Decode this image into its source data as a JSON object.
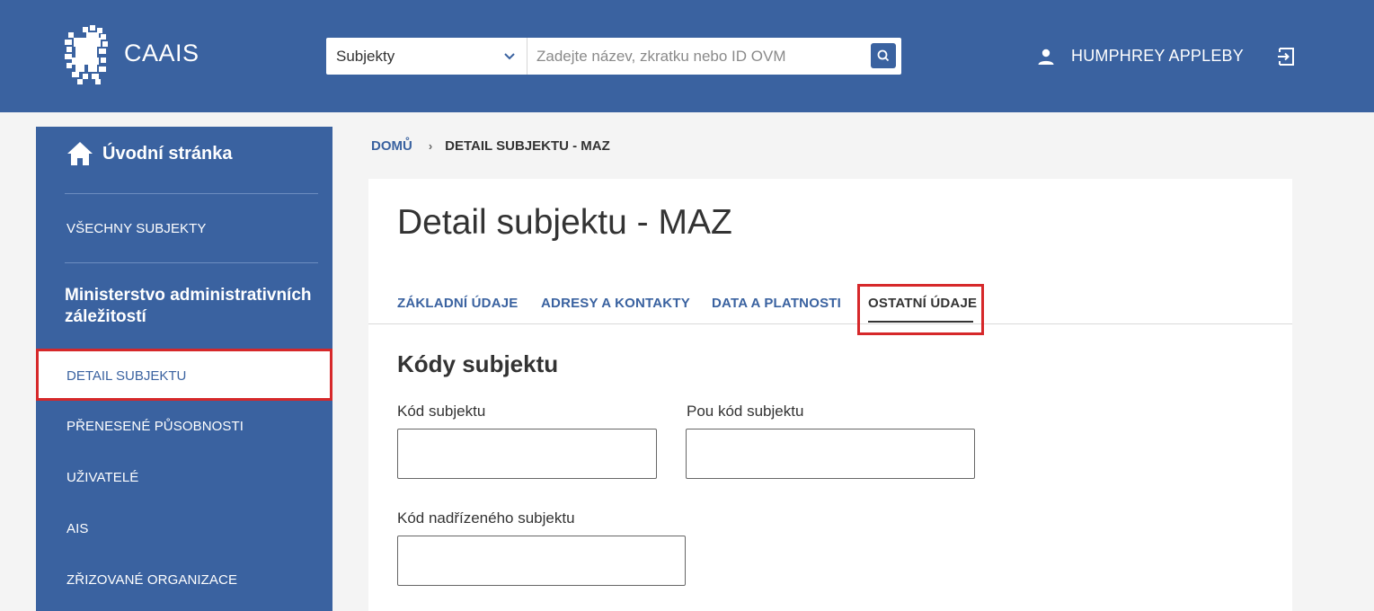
{
  "header": {
    "app_name": "CAAIS",
    "search": {
      "select_value": "Subjekty",
      "placeholder": "Zadejte název, zkratku nebo ID OVM"
    },
    "user_name": "HUMPHREY APPLEBY"
  },
  "sidebar": {
    "home_label": "Úvodní stránka",
    "all_subjects": "VŠECHNY SUBJEKTY",
    "org_title": "Ministerstvo administrativních záležitostí",
    "items": [
      {
        "label": "DETAIL SUBJEKTU",
        "active": true
      },
      {
        "label": "PŘENESENÉ PŮSOBNOSTI"
      },
      {
        "label": "UŽIVATELÉ"
      },
      {
        "label": "AIS"
      },
      {
        "label": "ZŘIZOVANÉ ORGANIZACE"
      }
    ]
  },
  "breadcrumb": {
    "home": "DOMŮ",
    "current": "DETAIL SUBJEKTU - MAZ"
  },
  "main": {
    "title": "Detail subjektu - MAZ",
    "tabs": [
      {
        "label": "ZÁKLADNÍ ÚDAJE"
      },
      {
        "label": "ADRESY A KONTAKTY"
      },
      {
        "label": "DATA A PLATNOSTI"
      },
      {
        "label": "OSTATNÍ ÚDAJE",
        "active": true
      }
    ],
    "section_title": "Kódy subjektu",
    "fields": {
      "kod_subjektu": {
        "label": "Kód subjektu",
        "value": ""
      },
      "pou_kod": {
        "label": "Pou kód subjektu",
        "value": ""
      },
      "kod_nadrizeneho": {
        "label": "Kód nadřízeného subjektu",
        "value": ""
      }
    }
  },
  "colors": {
    "brand_blue": "#3a62a0",
    "highlight_red": "#d6282a"
  }
}
